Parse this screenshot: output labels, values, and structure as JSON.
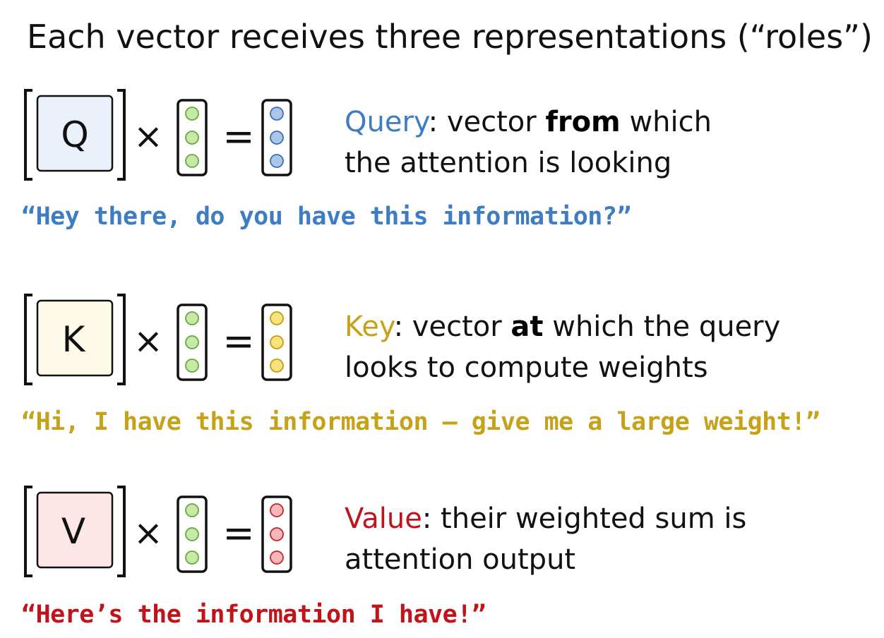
{
  "title": "Each vector receives three representations (“roles”)",
  "operators": {
    "times": "×",
    "equals": "="
  },
  "roles": [
    {
      "id": "query",
      "matrix_label": "Q",
      "name": "Query",
      "desc_part1": ": vector ",
      "desc_emph": "from",
      "desc_part2": " which",
      "desc_line2": "the attention is looking",
      "quote": "“Hey there, do you have this information?”",
      "matrix_fill": "#eaf1fb",
      "name_color": "#3e7cc4",
      "quote_color": "#3e7cc4",
      "circle_fill": "#a9c6ea",
      "circle_stroke": "#3d6fae"
    },
    {
      "id": "key",
      "matrix_label": "K",
      "name": "Key",
      "desc_part1": ": vector ",
      "desc_emph": "at",
      "desc_part2": " which the query",
      "desc_line2": "looks to compute weights",
      "quote": "“Hi, I have this information – give me a large weight!”",
      "matrix_fill": "#fefae8",
      "name_color": "#c5a21a",
      "quote_color": "#c5a21a",
      "circle_fill": "#f8e27a",
      "circle_stroke": "#c29c12"
    },
    {
      "id": "value",
      "matrix_label": "V",
      "name": "Value",
      "desc_part1": ": their weighted sum is",
      "desc_emph": "",
      "desc_part2": "",
      "desc_line2": "attention output",
      "quote": "“Here’s the information I have!”",
      "matrix_fill": "#fde6e6",
      "name_color": "#c0141a",
      "quote_color": "#c0141a",
      "circle_fill": "#f7b7b9",
      "circle_stroke": "#c4252b"
    }
  ],
  "input_vector": {
    "circle_fill": "#c6e8a8",
    "circle_stroke": "#6aa83b"
  }
}
